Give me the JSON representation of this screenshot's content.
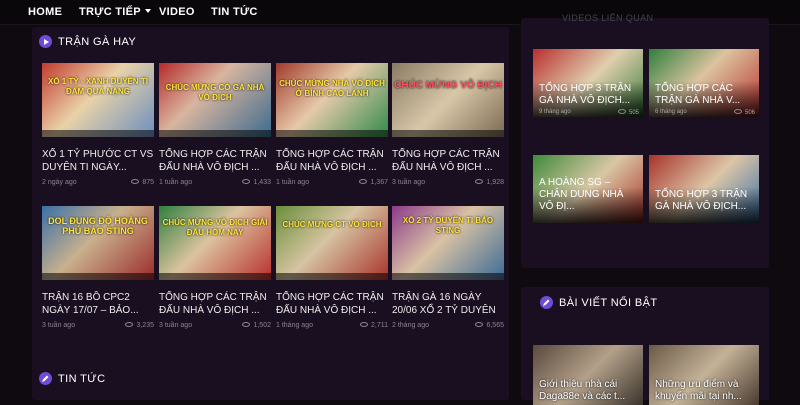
{
  "nav": [
    {
      "label": "HOME"
    },
    {
      "label": "TRỰC TIẾP",
      "dropdown": true
    },
    {
      "label": "VIDEO"
    },
    {
      "label": "TIN TỨC"
    }
  ],
  "sections": {
    "main": "TRẬN GÀ HAY",
    "news": "TIN TỨC",
    "related": "VIDEOS LIÊN QUAN",
    "featured": "BÀI VIẾT NỔI BẬT"
  },
  "videos": [
    {
      "title": "XỔ 1 TỶ PHƯỚC CT VS DUYÊN TI NGÀY...",
      "time": "2 ngày ago",
      "views": "875",
      "thumb": "XỔ 1 TỶ - XANH DUYÊN TI ĐÂM QUÁ NẶNG"
    },
    {
      "title": "TỔNG HỢP CÁC TRẬN ĐẤU NHÀ VÔ ĐỊCH ...",
      "time": "1 tuần ago",
      "views": "1,433",
      "thumb": "CHÚC MỪNG CÒ GÀ NHÀ VÔ ĐỊCH"
    },
    {
      "title": "TỔNG HỢP CÁC TRẬN ĐẤU NHÀ VÔ ĐỊCH ...",
      "time": "1 tuần ago",
      "views": "1,367",
      "thumb": "CHÚC MỪNG NHÀ VÔ ĐỊCH Ở BÌNH CAO LÃNH"
    },
    {
      "title": "TỔNG HỢP CÁC TRẬN ĐẤU NHÀ VÔ ĐỊCH ...",
      "time": "3 tuần ago",
      "views": "1,928",
      "thumb": "CHÚC MỪNG VÔ ĐỊCH"
    },
    {
      "title": "TRẬN 16 BỒ CPC2 NGÀY 17/07 – BẢO...",
      "time": "3 tuần ago",
      "views": "3,235",
      "thumb": "DOL ĐỤNG ĐỘ HOÀNG PHÚ BẢO STING"
    },
    {
      "title": "TỔNG HỢP CÁC TRẬN ĐẤU NHÀ VÔ ĐỊCH ...",
      "time": "3 tuần ago",
      "views": "1,502",
      "thumb": "CHÚC MỪNG VÔ ĐỊCH GIẢI ĐẤU HÔM NAY"
    },
    {
      "title": "TỔNG HỢP CÁC TRẬN ĐẤU NHÀ VÔ ĐỊCH ...",
      "time": "1 tháng ago",
      "views": "2,711",
      "thumb": "CHÚC MỪNG CT VÔ ĐỊCH"
    },
    {
      "title": "TRẬN GÀ 16 NGÀY 20/06 XỔ 2 TỶ DUYÊN TI V...",
      "time": "2 tháng ago",
      "views": "6,565",
      "thumb": "XỔ 2 TỶ DUYÊN TI BẢO STING"
    }
  ],
  "related": [
    {
      "title": "TỔNG HỢP 3 TRẬN GÀ NHÀ VÔ ĐỊCH...",
      "time": "9 tháng ago",
      "views": "505"
    },
    {
      "title": "TỔNG HỢP CÁC TRẬN GÀ NHÀ V...",
      "time": "6 tháng ago",
      "views": "506"
    },
    {
      "title": "A HOÀNG SG – CHÂN DUNG NHÀ VÔ ĐỊ...",
      "time": "",
      "views": ""
    },
    {
      "title": "TỔNG HỢP 3 TRẬN GÀ NHÀ VÔ ĐỊCH...",
      "time": "",
      "views": ""
    }
  ],
  "featured": [
    {
      "title": "Giới thiệu nhà cái Daga88e và các t..."
    },
    {
      "title": "Những ưu điểm và khuyến mãi tại nh..."
    }
  ],
  "colors": {
    "accent": "#6f4bd8",
    "panel": "#1a0f20",
    "background": "#0e0a10"
  }
}
